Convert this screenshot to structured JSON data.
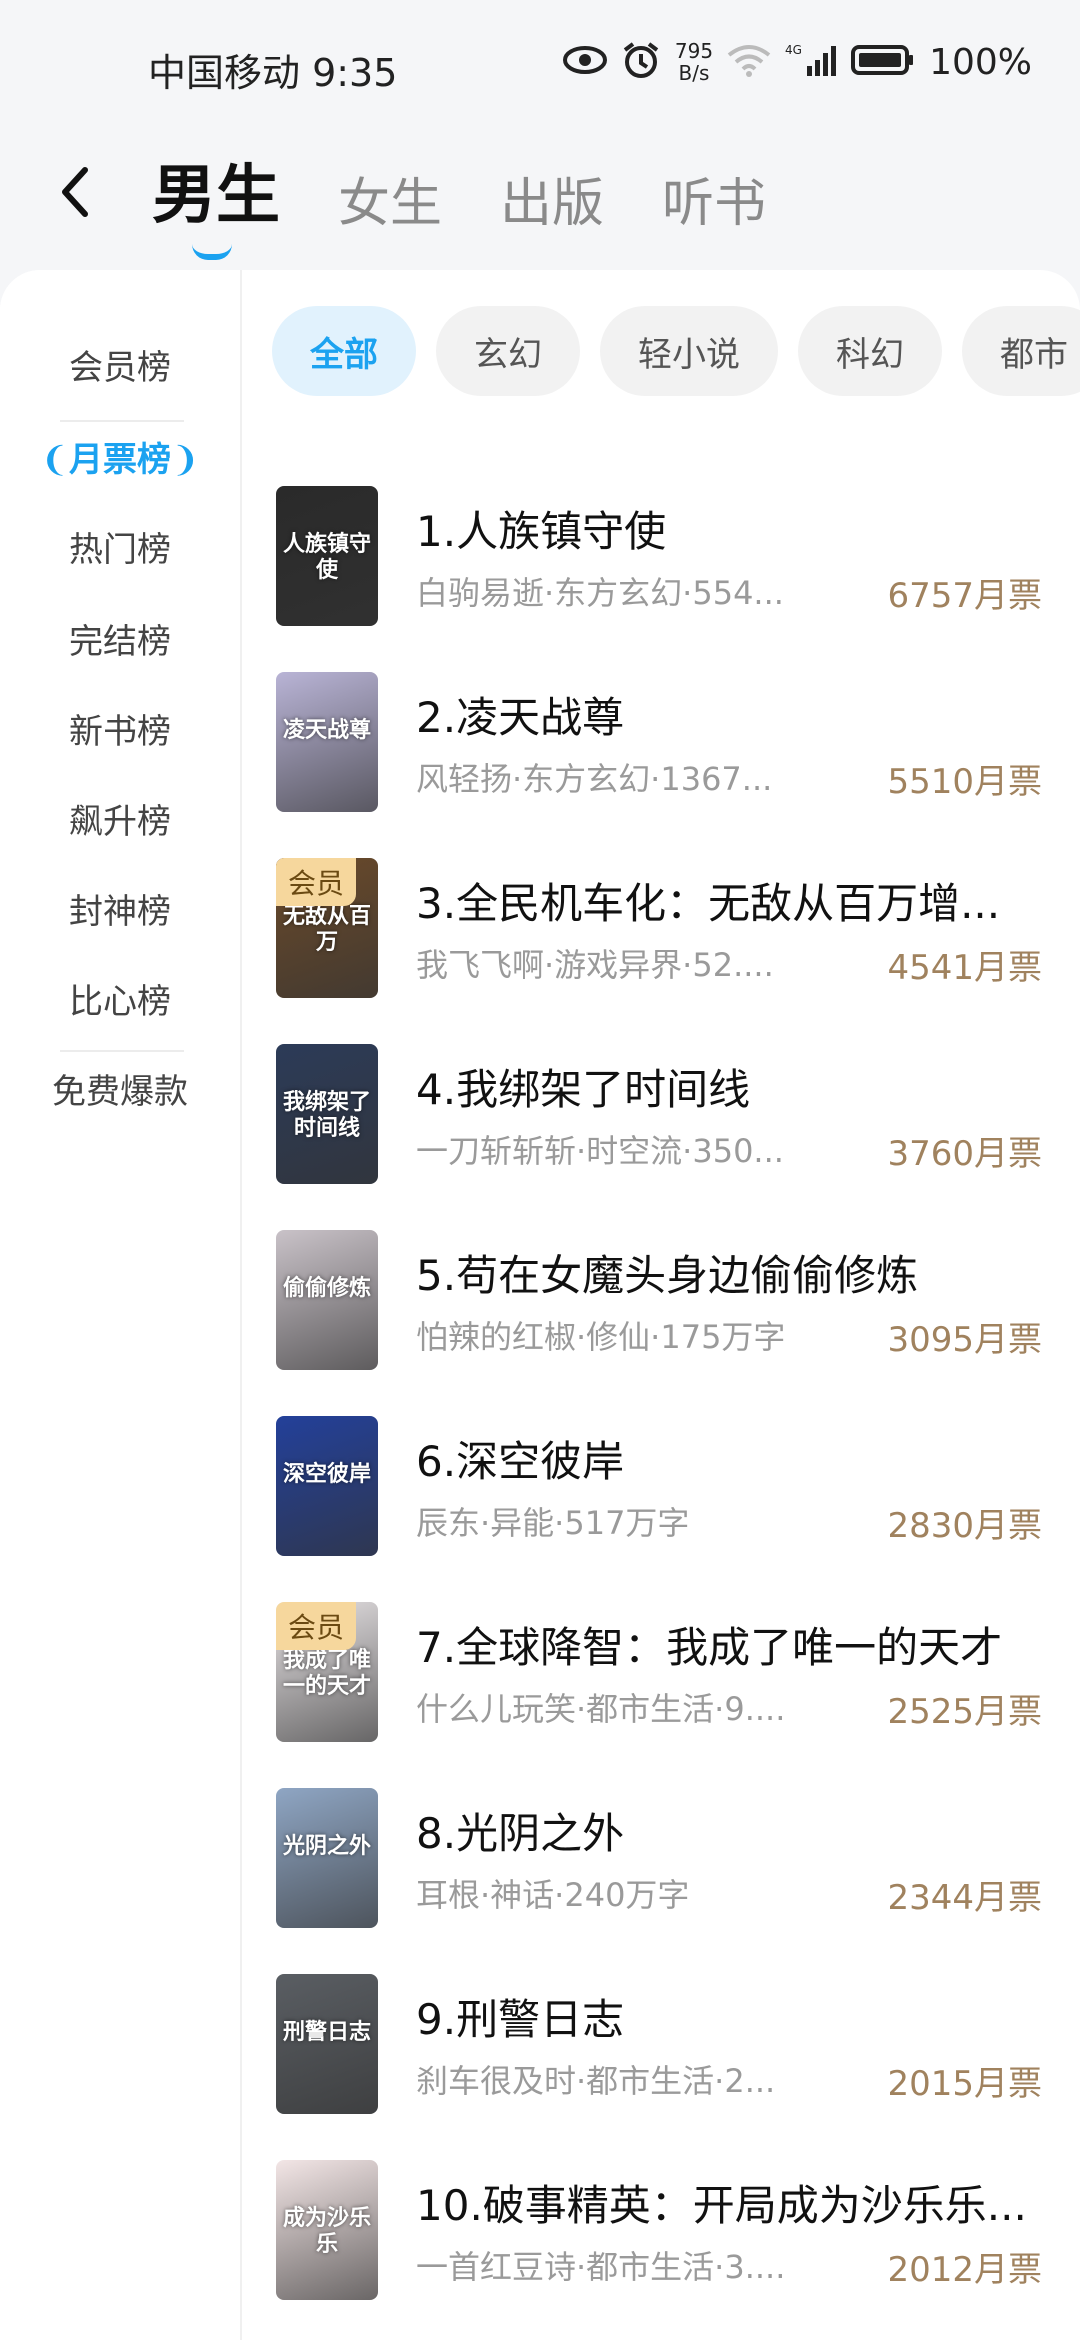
{
  "status_bar": {
    "carrier_time": "中国移动 9:35",
    "net_speed_value": "795",
    "net_speed_unit": "B/s",
    "battery": "100%",
    "icons": [
      "eye-icon",
      "alarm-icon",
      "wifi-icon",
      "signal-4g-icon",
      "battery-icon"
    ]
  },
  "top_tabs": [
    {
      "label": "男生",
      "active": true
    },
    {
      "label": "女生",
      "active": false
    },
    {
      "label": "出版",
      "active": false
    },
    {
      "label": "听书",
      "active": false
    }
  ],
  "sidebar": {
    "items": [
      {
        "label": "会员榜"
      },
      {
        "label": "月票榜",
        "active": true
      },
      {
        "label": "热门榜"
      },
      {
        "label": "完结榜"
      },
      {
        "label": "新书榜"
      },
      {
        "label": "飙升榜"
      },
      {
        "label": "封神榜"
      },
      {
        "label": "比心榜"
      },
      {
        "label": "免费爆款"
      }
    ]
  },
  "chips": [
    {
      "label": "全部",
      "active": true
    },
    {
      "label": "玄幻"
    },
    {
      "label": "轻小说"
    },
    {
      "label": "科幻"
    },
    {
      "label": "都市"
    }
  ],
  "books": [
    {
      "title": "1.人族镇守使",
      "meta": "白驹易逝·东方玄幻·554...",
      "votes": "6757月票",
      "vip": false,
      "cover_text": "人族镇守使",
      "cover_color": "#2a2a2a"
    },
    {
      "title": "2.凌天战尊",
      "meta": "风轻扬·东方玄幻·1367...",
      "votes": "5510月票",
      "vip": false,
      "cover_text": "凌天战尊",
      "cover_color": "#b9b4d6"
    },
    {
      "title": "3.全民机车化：无敌从百万增...",
      "meta": "我飞飞啊·游戏异界·52....",
      "votes": "4541月票",
      "vip": true,
      "vip_label": "会员",
      "cover_text": "无敌从百万",
      "cover_color": "#6b4a2a"
    },
    {
      "title": "4.我绑架了时间线",
      "meta": "一刀斩斩斩·时空流·350...",
      "votes": "3760月票",
      "vip": false,
      "cover_text": "我绑架了时间线",
      "cover_color": "#2c3b58"
    },
    {
      "title": "5.苟在女魔头身边偷偷修炼",
      "meta": "怕辣的红椒·修仙·175万字",
      "votes": "3095月票",
      "vip": false,
      "cover_text": "偷偷修炼",
      "cover_color": "#c9c2c8"
    },
    {
      "title": "6.深空彼岸",
      "meta": "辰东·异能·517万字",
      "votes": "2830月票",
      "vip": false,
      "cover_text": "深空彼岸",
      "cover_color": "#23409a"
    },
    {
      "title": "7.全球降智：我成了唯一的天才",
      "meta": "什么儿玩笑·都市生活·9....",
      "votes": "2525月票",
      "vip": true,
      "vip_label": "会员",
      "cover_text": "我成了唯一的天才",
      "cover_color": "#e8e4e6"
    },
    {
      "title": "8.光阴之外",
      "meta": "耳根·神话·240万字",
      "votes": "2344月票",
      "vip": false,
      "cover_text": "光阴之外",
      "cover_color": "#8fa6c4"
    },
    {
      "title": "9.刑警日志",
      "meta": "刹车很及时·都市生活·2...",
      "votes": "2015月票",
      "vip": false,
      "cover_text": "刑警日志",
      "cover_color": "#5a5e63"
    },
    {
      "title": "10.破事精英：开局成为沙乐乐...",
      "meta": "一首红豆诗·都市生活·3....",
      "votes": "2012月票",
      "vip": false,
      "cover_text": "成为沙乐乐",
      "cover_color": "#f3e6e6"
    }
  ],
  "colors": {
    "accent": "#1ba2f0",
    "votes": "#a0825e",
    "vip_badge": "#f6d79d"
  }
}
